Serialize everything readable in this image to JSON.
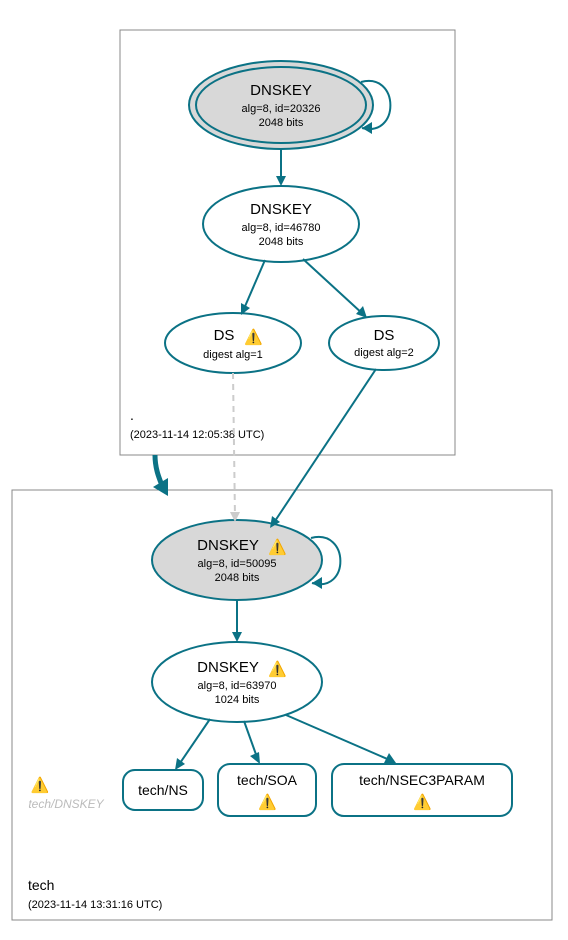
{
  "zones": {
    "root": {
      "label": ".",
      "timestamp": "(2023-11-14 12:05:38 UTC)"
    },
    "tech": {
      "label": "tech",
      "timestamp": "(2023-11-14 13:31:16 UTC)"
    }
  },
  "nodes": {
    "root_ksk": {
      "title": "DNSKEY",
      "line1": "alg=8, id=20326",
      "line2": "2048 bits",
      "warn": false
    },
    "root_zsk": {
      "title": "DNSKEY",
      "line1": "alg=8, id=46780",
      "line2": "2048 bits",
      "warn": false
    },
    "ds1": {
      "title": "DS",
      "line1": "digest alg=1",
      "line2": "",
      "warn": true
    },
    "ds2": {
      "title": "DS",
      "line1": "digest alg=2",
      "line2": "",
      "warn": false
    },
    "tech_ksk": {
      "title": "DNSKEY",
      "line1": "alg=8, id=50095",
      "line2": "2048 bits",
      "warn": true
    },
    "tech_zsk": {
      "title": "DNSKEY",
      "line1": "alg=8, id=63970",
      "line2": "1024 bits",
      "warn": true
    },
    "tech_ns": {
      "title": "tech/NS",
      "warn": false
    },
    "tech_soa": {
      "title": "tech/SOA",
      "warn": true
    },
    "tech_nsec3": {
      "title": "tech/NSEC3PARAM",
      "warn": true
    },
    "tech_dnskey_gray": {
      "title": "tech/DNSKEY",
      "warn": true
    }
  },
  "icons": {
    "warn": "⚠️"
  }
}
